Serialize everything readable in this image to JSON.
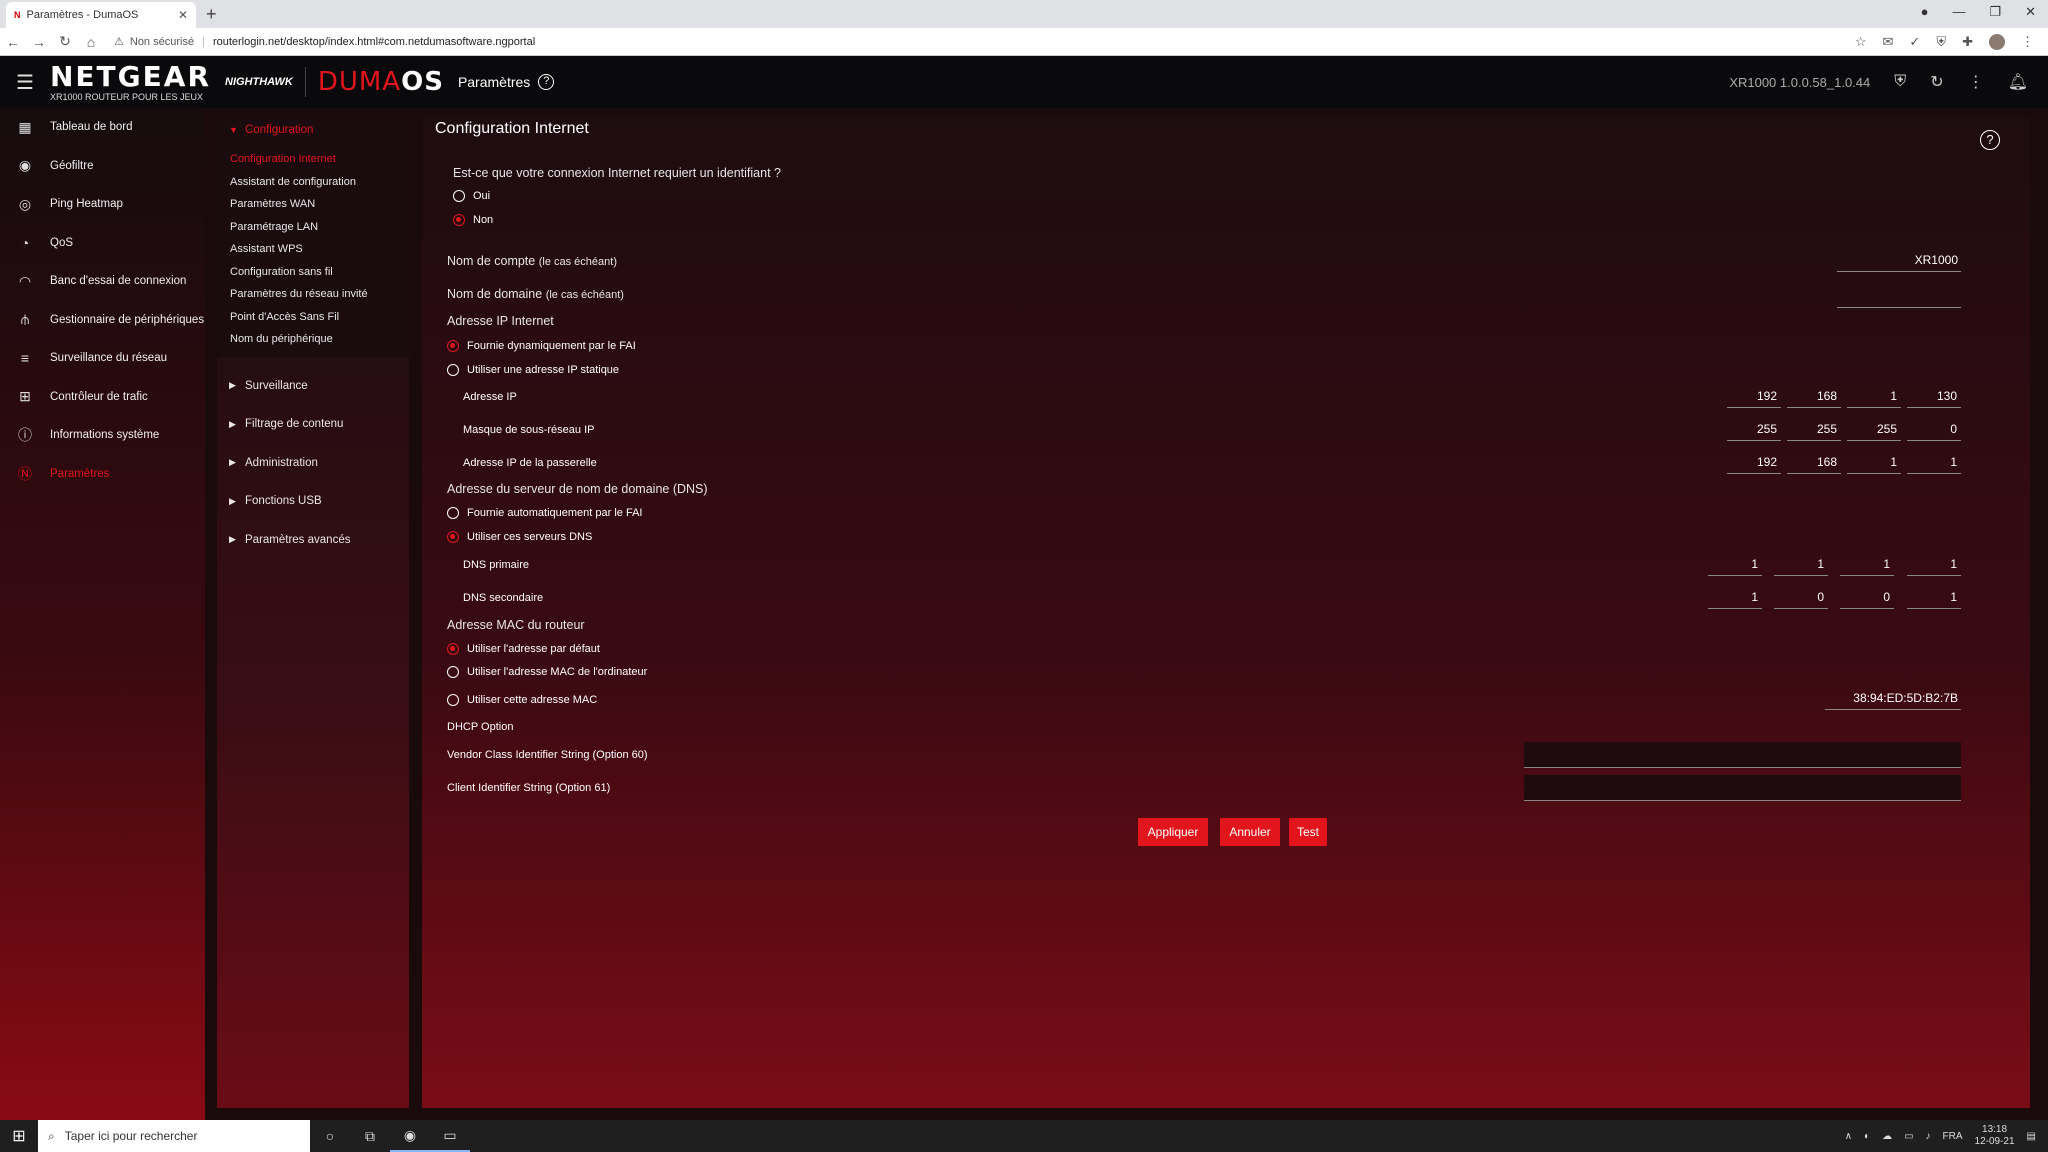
{
  "browser": {
    "tab_title": "Paramètres - DumaOS",
    "tab_favicon": "N",
    "security_label": "Non sécurisé",
    "url": "routerlogin.net/desktop/index.html#com.netdumasoftware.ngportal"
  },
  "header": {
    "brand": "NETGEAR",
    "brand_sub": "XR1000 ROUTEUR POUR LES JEUX",
    "nighthawk": "NIGHTHAWK",
    "duma_red": "DUMA",
    "duma_white": "OS",
    "page": "Paramètres",
    "version": "XR1000 1.0.0.58_1.0.44"
  },
  "sidebar": {
    "items": [
      {
        "label": "Tableau de bord",
        "icon": "dashboard-icon"
      },
      {
        "label": "Géofiltre",
        "icon": "geofilter-icon"
      },
      {
        "label": "Ping Heatmap",
        "icon": "ping-heatmap-icon"
      },
      {
        "label": "QoS",
        "icon": "qos-icon"
      },
      {
        "label": "Banc d'essai de connexion",
        "icon": "benchmark-icon"
      },
      {
        "label": "Gestionnaire de périphériques",
        "icon": "device-manager-icon"
      },
      {
        "label": "Surveillance du réseau",
        "icon": "network-monitor-icon"
      },
      {
        "label": "Contrôleur de trafic",
        "icon": "traffic-controller-icon"
      },
      {
        "label": "Informations système",
        "icon": "system-info-icon"
      },
      {
        "label": "Paramètres",
        "icon": "settings-icon"
      }
    ]
  },
  "submenu": {
    "open_section": "Configuration",
    "open_items": [
      "Configuration Internet",
      "Assistant de configuration",
      "Paramètres WAN",
      "Paramétrage LAN",
      "Assistant WPS",
      "Configuration sans fil",
      "Paramètres du réseau invité",
      "Point d'Accès Sans Fil",
      "Nom du périphérique"
    ],
    "closed_sections": [
      "Surveillance",
      "Filtrage de contenu",
      "Administration",
      "Fonctions USB",
      "Paramètres avancés"
    ]
  },
  "main": {
    "title": "Configuration Internet",
    "login_question": "Est-ce que votre connexion Internet requiert un identifiant ?",
    "login_yes": "Oui",
    "login_no": "Non",
    "account_label": "Nom de compte",
    "account_hint": "(le cas échéant)",
    "account_value": "XR1000",
    "domain_label": "Nom de domaine",
    "domain_hint": "(le cas échéant)",
    "domain_value": "",
    "ip_section": "Adresse IP Internet",
    "ip_dynamic": "Fournie dynamiquement par le FAI",
    "ip_static": "Utiliser une adresse IP statique",
    "ip_label": "Adresse IP",
    "ip": [
      "192",
      "168",
      "1",
      "130"
    ],
    "mask_label": "Masque de sous-réseau IP",
    "mask": [
      "255",
      "255",
      "255",
      "0"
    ],
    "gateway_label": "Adresse IP de la passerelle",
    "gateway": [
      "192",
      "168",
      "1",
      "1"
    ],
    "dns_section": "Adresse du serveur de nom de domaine (DNS)",
    "dns_auto": "Fournie automatiquement par le FAI",
    "dns_manual": "Utiliser ces serveurs DNS",
    "dns1_label": "DNS primaire",
    "dns1": [
      "1",
      "1",
      "1",
      "1"
    ],
    "dns2_label": "DNS secondaire",
    "dns2": [
      "1",
      "0",
      "0",
      "1"
    ],
    "mac_section": "Adresse MAC du routeur",
    "mac_default": "Utiliser l'adresse par défaut",
    "mac_computer": "Utiliser l'adresse MAC de l'ordinateur",
    "mac_custom": "Utiliser cette adresse MAC",
    "mac_value": "38:94:ED:5D:B2:7B",
    "dhcp_section": "DHCP Option",
    "vendor_label": "Vendor Class Identifier String (Option 60)",
    "client_label": "Client Identifier String (Option 61)",
    "apply": "Appliquer",
    "cancel": "Annuler",
    "test": "Test"
  },
  "taskbar": {
    "search_placeholder": "Taper ici pour rechercher",
    "lang": "FRA",
    "time": "13:18",
    "date": "12-09-21"
  },
  "colors": {
    "accent": "#e2151d"
  }
}
